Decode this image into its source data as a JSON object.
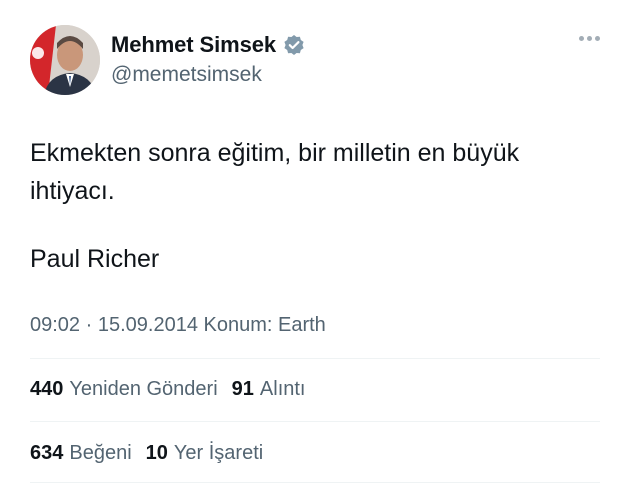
{
  "author": {
    "display_name": "Mehmet Simsek",
    "handle": "@memetsimsek",
    "verified_color": "#829aab"
  },
  "tweet": {
    "text": "Ekmekten sonra eğitim, bir milletin en büyük ihtiyacı.",
    "signature": "Paul Richer"
  },
  "meta": {
    "time": "09:02",
    "separator": " · ",
    "date": "15.09.2014",
    "location": " Konum: Earth"
  },
  "stats": {
    "reposts": {
      "count": "440",
      "label": "Yeniden Gönderi"
    },
    "quotes": {
      "count": "91",
      "label": "Alıntı"
    },
    "likes": {
      "count": "634",
      "label": "Beğeni"
    },
    "bookmarks": {
      "count": "10",
      "label": "Yer İşareti"
    }
  },
  "icons": {
    "more": "more-horizontal-icon",
    "verified": "verified-badge-icon"
  }
}
